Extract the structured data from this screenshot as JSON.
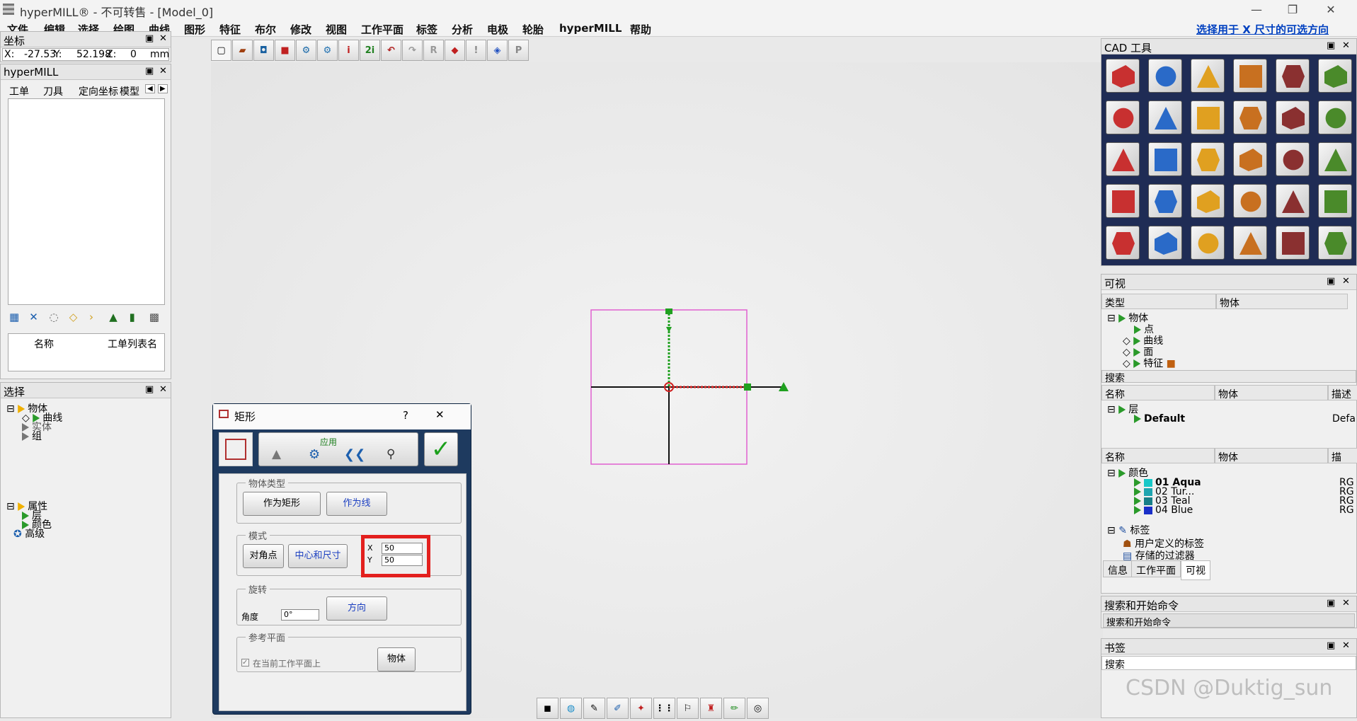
{
  "window": {
    "title": "hyperMILL® - 不可转售 - [Model_0]",
    "minimize": "—",
    "restore": "❐",
    "close": "✕"
  },
  "menu": [
    "文件",
    "编辑",
    "选择",
    "绘图",
    "曲线",
    "图形",
    "特征",
    "布尔",
    "修改",
    "视图",
    "工作平面",
    "标签",
    "分析",
    "电极",
    "轮胎",
    "hyperMILL",
    "帮助"
  ],
  "hint": "选择用于 X 尺寸的可选方向",
  "toolbar_icons": [
    "new-icon",
    "open-icon",
    "save-icon",
    "box-icon",
    "gear-icon",
    "setup-icon",
    "info-icon",
    "text-2i-icon",
    "undo-icon",
    "redo-icon",
    "reset-icon",
    "solid-icon",
    "warning-icon",
    "layers-icon",
    "p-icon"
  ],
  "coords": {
    "title": "坐标",
    "x_label": "X:",
    "x": "-27.53",
    "y_label": "Y:",
    "y": "52.198",
    "z_label": "Z:",
    "z": "0",
    "unit": "mm"
  },
  "hypermill": {
    "title": "hyperMILL",
    "tabs": [
      "工单",
      "刀具",
      "定向坐标",
      "模型"
    ],
    "columns": [
      "名称",
      "工单列表名"
    ]
  },
  "select": {
    "title": "选择",
    "tree": [
      "物体",
      "曲线",
      "实体",
      "组"
    ],
    "tree2": [
      "属性",
      "层",
      "颜色",
      "高级"
    ]
  },
  "dialog": {
    "title": "矩形",
    "help": "?",
    "close": "✕",
    "apply": "应用",
    "object_type": {
      "legend": "物体类型",
      "btn_rect": "作为矩形",
      "btn_line": "作为线"
    },
    "mode": {
      "legend": "模式",
      "btn_corner": "对角点",
      "btn_center": "中心和尺寸",
      "x_label": "X",
      "x": "50",
      "y_label": "Y",
      "y": "50"
    },
    "rotation": {
      "legend": "旋转",
      "angle_label": "角度",
      "angle": "0°",
      "btn_dir": "方向"
    },
    "ref": {
      "legend": "参考平面",
      "checkbox": "在当前工作平面上",
      "btn_obj": "物体"
    }
  },
  "cad": {
    "title": "CAD 工具",
    "tools": [
      "cube-info-icon",
      "text-2i-icon",
      "surface-info-icon",
      "star-info-icon",
      "arc-icon",
      "curve-edit-icon",
      "curve-d-icon",
      "plane-icon",
      "solid-cut-icon",
      "surface-yellow-icon",
      "axis-curve-icon",
      "rectangle-icon",
      "circle-r-icon",
      "zigzag-icon",
      "spline-icon",
      "line-surface-icon",
      "solid-s-icon",
      "ribbon-icon",
      "plane-yellow-icon",
      "surface-orange-icon",
      "fold-icon",
      "cup-icon",
      "sweep-icon",
      "t-beam-icon",
      "red-box-icon",
      "step-icon",
      "cylinders-icon",
      "cone-icon",
      "shell-icon",
      "blue-cube-icon"
    ]
  },
  "visible": {
    "title": "可视",
    "col_type": "类型",
    "col_obj": "物体",
    "tree": [
      "物体",
      "点",
      "曲线",
      "面",
      "特征"
    ],
    "search": "搜索",
    "layers": {
      "col_name": "名称",
      "col_obj": "物体",
      "col_desc": "描述",
      "root": "层",
      "default": "Default",
      "default_desc": "Defa"
    },
    "colors": {
      "col_name": "名称",
      "col_obj": "物体",
      "col_desc": "描",
      "root": "颜色",
      "items": [
        {
          "name": "01 Aqua",
          "swatch": "#17c8c8",
          "rg": "RG"
        },
        {
          "name": "02 Tur...",
          "swatch": "#1ea5b0",
          "rg": "RG"
        },
        {
          "name": "03 Teal",
          "swatch": "#177f88",
          "rg": "RG"
        },
        {
          "name": "04 Blue",
          "swatch": "#1a2fc8",
          "rg": "RG"
        }
      ]
    },
    "tags": "标签",
    "user_tags": "用户定义的标签",
    "saved_filters": "存储的过滤器",
    "tabs": [
      "信息",
      "工作平面",
      "可视"
    ]
  },
  "search_cmd": {
    "title": "搜索和开始命令",
    "placeholder": "搜索和开始命令"
  },
  "bookmarks": {
    "title": "书签",
    "search": "搜索"
  },
  "watermark": "CSDN @Duktig_sun",
  "bottom_icons": [
    "shade-icon",
    "globe-icon",
    "draw-icon",
    "brush-icon",
    "pin-icon",
    "grid-icon",
    "walk-icon",
    "tool-icon",
    "pen-icon",
    "sphere-icon"
  ]
}
